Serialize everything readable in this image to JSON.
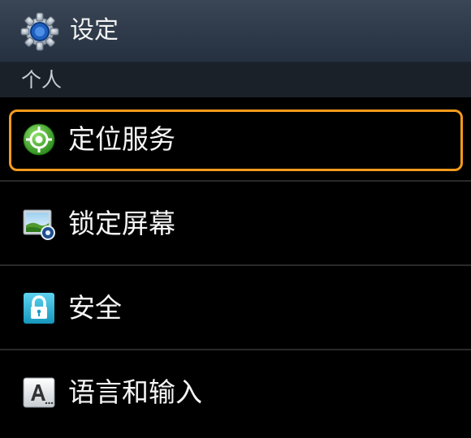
{
  "app": {
    "title": "设定",
    "title_icon": "settings-gear-icon"
  },
  "section": {
    "header": "个人"
  },
  "items": [
    {
      "label": "定位服务",
      "icon": "location-icon",
      "selected": true
    },
    {
      "label": "锁定屏幕",
      "icon": "lock-screen-icon",
      "selected": false
    },
    {
      "label": "安全",
      "icon": "security-lock-icon",
      "selected": false
    },
    {
      "label": "语言和输入",
      "icon": "language-input-icon",
      "selected": false
    }
  ],
  "colors": {
    "focus": "#f59a1c",
    "title_bar": "#2e3a49",
    "section_bar": "#1b2128",
    "location_green": "#3fae2a",
    "security_cyan": "#22b6d8"
  }
}
